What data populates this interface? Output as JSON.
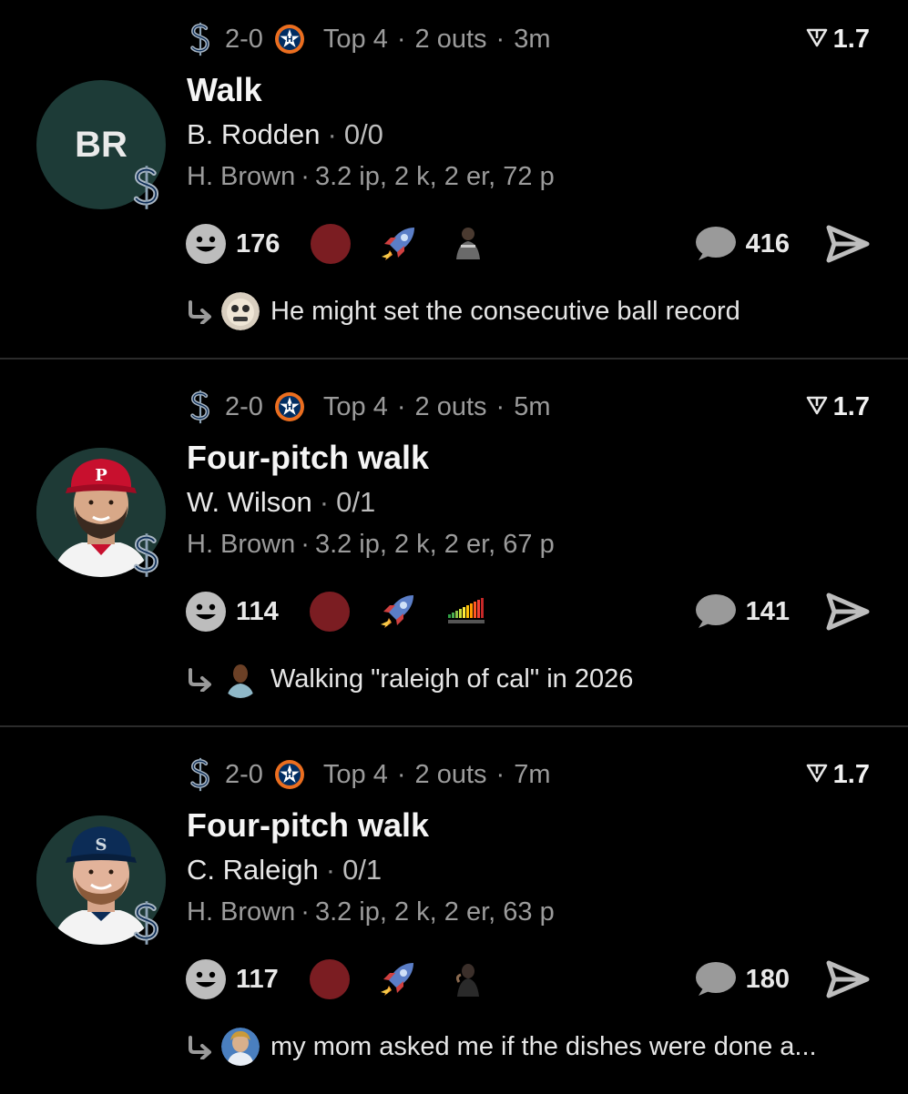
{
  "colors": {
    "background": "#000000",
    "divider": "#2b2b2b",
    "avatar_bg": "#1d3b37",
    "red_reaction": "#7b1d22",
    "muted_text": "#9b9b9b"
  },
  "cards": [
    {
      "score": "2-0",
      "inning": "Top 4",
      "outs": "2 outs",
      "time": "3m",
      "probability": "1.7",
      "title": "Walk",
      "batter_name": "B. Rodden",
      "batter_stat": "0/0",
      "pitcher_line": "H. Brown",
      "pitcher_stats": "3.2 ip, 2 k, 2 er, 72 p",
      "avatar_initials": "BR",
      "reaction_count": "176",
      "comment_count": "416",
      "reply_text": "He might set the consecutive ball record",
      "icons": [
        "smile-icon",
        "red-dot",
        "rocket-icon",
        "sticker",
        "comment-bubble-icon",
        "share-icon",
        "reply-arrow-icon"
      ]
    },
    {
      "score": "2-0",
      "inning": "Top 4",
      "outs": "2 outs",
      "time": "5m",
      "probability": "1.7",
      "title": "Four-pitch walk",
      "batter_name": "W. Wilson",
      "batter_stat": "0/1",
      "pitcher_line": "H. Brown",
      "pitcher_stats": "3.2 ip, 2 k, 2 er, 67 p",
      "avatar_initials": "",
      "reaction_count": "114",
      "comment_count": "141",
      "reply_text": "Walking \"raleigh of cal\" in 2026",
      "icons": [
        "smile-icon",
        "red-dot",
        "rocket-icon",
        "sticker",
        "comment-bubble-icon",
        "share-icon",
        "reply-arrow-icon"
      ]
    },
    {
      "score": "2-0",
      "inning": "Top 4",
      "outs": "2 outs",
      "time": "7m",
      "probability": "1.7",
      "title": "Four-pitch walk",
      "batter_name": "C. Raleigh",
      "batter_stat": "0/1",
      "pitcher_line": "H. Brown",
      "pitcher_stats": "3.2 ip, 2 k, 2 er, 63 p",
      "avatar_initials": "",
      "reaction_count": "117",
      "comment_count": "180",
      "reply_text": "my mom asked me if the dishes were done a...",
      "icons": [
        "smile-icon",
        "red-dot",
        "rocket-icon",
        "sticker",
        "comment-bubble-icon",
        "share-icon",
        "reply-arrow-icon"
      ]
    }
  ]
}
